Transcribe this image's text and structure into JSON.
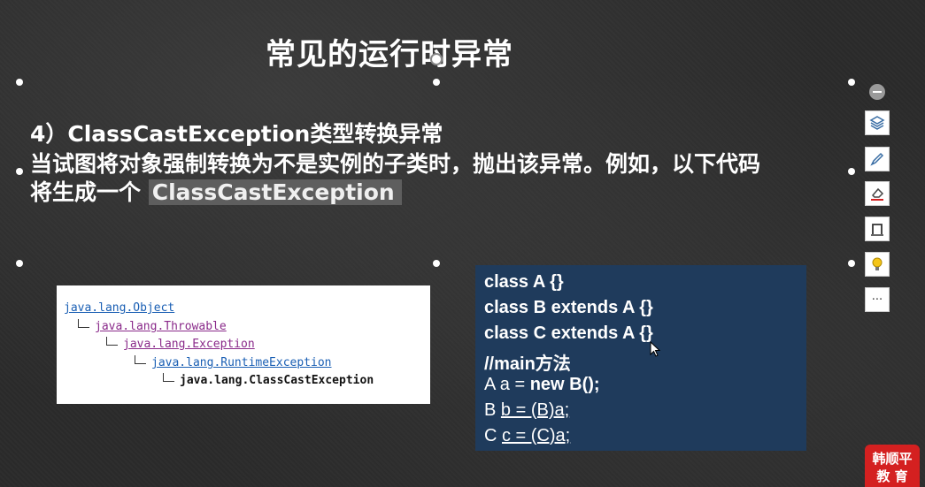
{
  "slide": {
    "title": "常见的运行时异常",
    "heading": "4）ClassCastException类型转换异常",
    "line1": "当试图将对象强制转换为不是实例的子类时，抛出该异常。例如，以下代码",
    "line2_prefix": "将生成一个 ",
    "line2_highlight": "ClassCastException"
  },
  "hierarchy": [
    "java.lang.Object",
    "java.lang.Throwable",
    "java.lang.Exception",
    "java.lang.RuntimeException",
    "java.lang.ClassCastException"
  ],
  "code": {
    "l1": "class A {}",
    "l2": "class B extends A {}",
    "l3": "class C extends A {}",
    "l4": "//main方法",
    "l5a": "A a = ",
    "l5b": "new B();",
    "l6a": "B ",
    "l6b": "b = (B)a;",
    "l7a": "C ",
    "l7b": "c = (C)a;"
  },
  "toolbar": {
    "items": [
      "minus-icon",
      "layers-icon",
      "pen-icon",
      "eraser-icon",
      "frame-icon",
      "lightbulb-icon"
    ],
    "more_label": "···"
  },
  "logo": {
    "line1": "韩顺平",
    "line2": "教 育"
  },
  "colors": {
    "background": "#2b2b2b",
    "code_bg": "#1f3b5c",
    "logo_red": "#d42020"
  }
}
